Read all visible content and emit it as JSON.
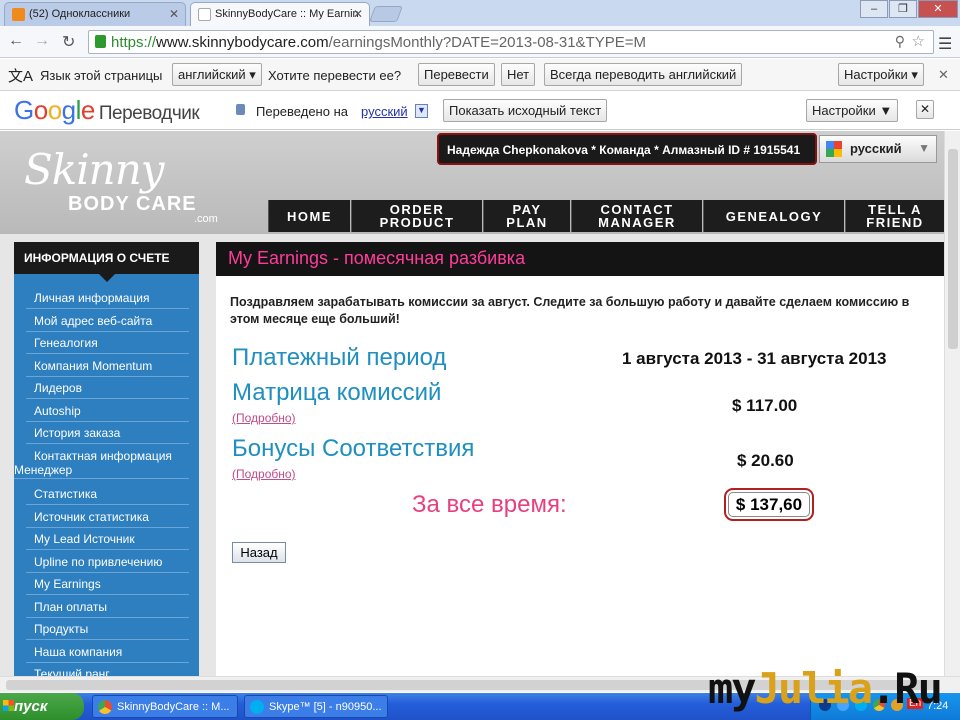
{
  "browser": {
    "tabs": [
      {
        "label": "(52) Одноклассники",
        "favicon_color": "#f08a1c"
      },
      {
        "label": "SkinnyBodyCare :: My Earnin",
        "favicon_color": "#ffffff"
      }
    ],
    "window_controls": {
      "minimize": "–",
      "maximize": "❐",
      "close": "✕"
    },
    "url": {
      "scheme": "https://",
      "host": "www.skinnybodycare.com",
      "path": "/earningsMonthly?DATE=2013-08-31&TYPE=M"
    }
  },
  "translate_bar": {
    "question": "Язык этой страницы",
    "language": "английский",
    "prompt": "Хотите перевести ее?",
    "translate": "Перевести",
    "no": "Нет",
    "always": "Всегда переводить английский",
    "settings": "Настройки"
  },
  "google_translate": {
    "logo": "Google",
    "product": "Переводчик",
    "translated_to": "Переведено на",
    "language": "русский",
    "show_original": "Показать исходный текст",
    "settings": "Настройки ▼",
    "close": "✕"
  },
  "site": {
    "logo": {
      "top": "Skinny",
      "middle": "BODY CARE",
      "suffix": ".com"
    },
    "user_info": "Надежда Chepkonakova * Команда * Алмазный ID # 1915541",
    "language_select": "русский",
    "nav": [
      {
        "line1": "HOME",
        "line2": ""
      },
      {
        "line1": "ORDER",
        "line2": "PRODUCT"
      },
      {
        "line1": "PAY",
        "line2": "PLAN"
      },
      {
        "line1": "CONTACT",
        "line2": "MANAGER"
      },
      {
        "line1": "GENEALOGY",
        "line2": ""
      },
      {
        "line1": "TELL A",
        "line2": "FRIEND"
      }
    ],
    "sidebar": {
      "title": "ИНФОРМАЦИЯ О СЧЕТЕ",
      "items": [
        "Личная информация",
        "Мой адрес веб-сайта",
        "Генеалогия",
        "Компания Momentum",
        "Лидеров",
        "Autoship",
        "История заказа",
        "Контактная информация",
        "Менеджер",
        "Статистика",
        "Источник статистика",
        "My Lead Источник",
        "Upline по привлечению",
        "My Earnings",
        "План оплаты",
        "Продукты",
        "Наша компания",
        "Текущий ранг"
      ]
    },
    "main": {
      "title": "My Earnings - помесячная разбивка",
      "congrats": "Поздравляем зарабатывать комиссии за август. Следите за большую работу и давайте сделаем комиссию в этом месяце еще больший!",
      "period_label": "Платежный период",
      "period_value": "1 августа 2013 - 31 августа 2013",
      "matrix_label": "Матрица комиссий",
      "matrix_link": "(Подробно)",
      "matrix_value": "$ 117.00",
      "bonus_label": "Бонусы Соответствия",
      "bonus_link": "(Подробно)",
      "bonus_value": "$ 20.60",
      "total_label": "За все время:",
      "total_value": "$ 137,60",
      "back_button": "Назад"
    }
  },
  "taskbar": {
    "start": "пуск",
    "items": [
      {
        "label": "SkinnyBodyCare :: M...",
        "icon_color": "#e84d2e"
      },
      {
        "label": "Skype™ [5] - n90950...",
        "icon_color": "#00aff0"
      }
    ],
    "lang_indicator": "En",
    "clock": "7:24"
  },
  "watermark": {
    "part1": "my",
    "part2": "Julia",
    "part3": ".Ru"
  }
}
